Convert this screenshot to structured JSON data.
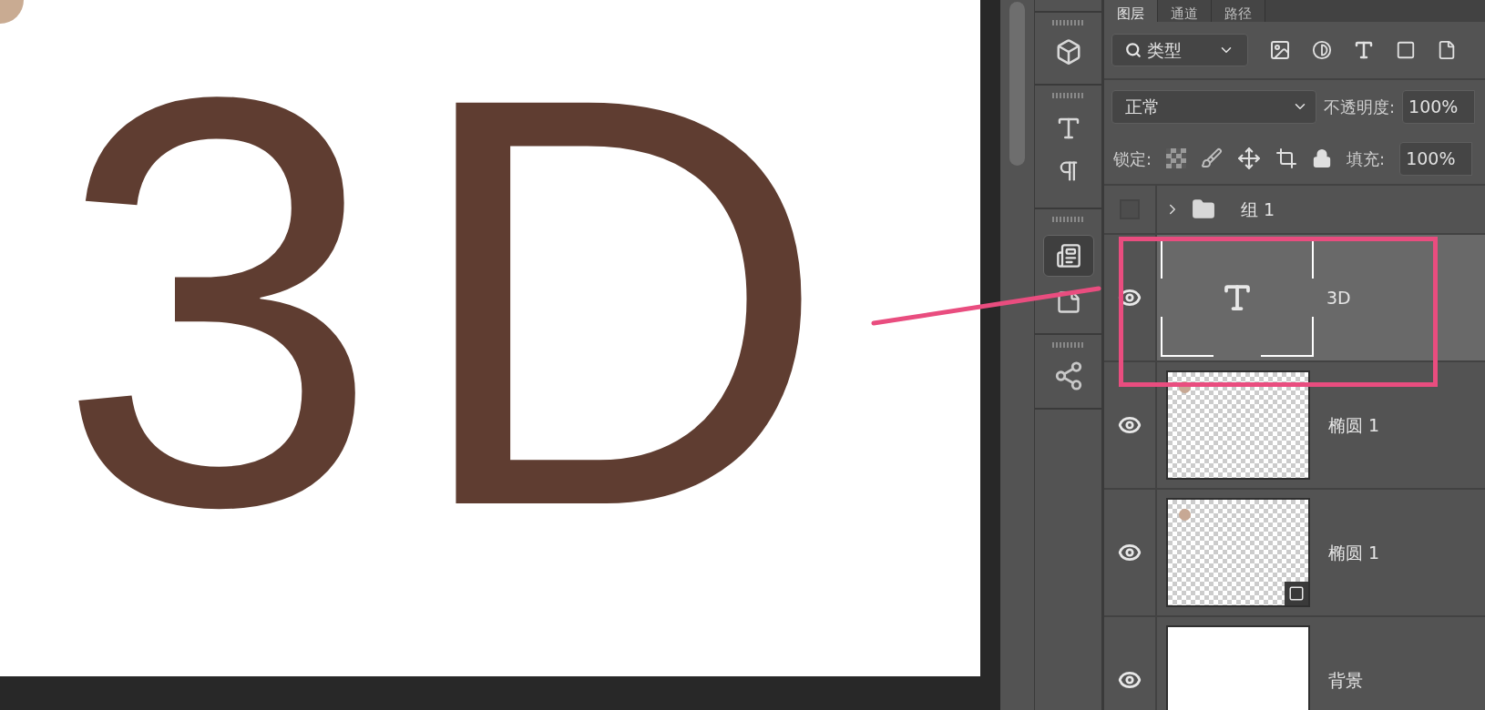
{
  "canvas": {
    "text": "3D"
  },
  "panel_tabs": [
    {
      "label": "图层",
      "selected": true
    },
    {
      "label": "通道",
      "selected": false
    },
    {
      "label": "路径",
      "selected": false
    }
  ],
  "filter": {
    "value": "类型"
  },
  "blend_mode": {
    "value": "正常"
  },
  "opacity": {
    "label": "不透明度:",
    "value": "100%"
  },
  "lock": {
    "label": "锁定:"
  },
  "fill": {
    "label": "填充:",
    "value": "100%"
  },
  "layers": [
    {
      "kind": "group",
      "name": "组 1",
      "visible": false,
      "expanded": false,
      "selected": false
    },
    {
      "kind": "text",
      "name": "3D",
      "visible": true,
      "selected": true
    },
    {
      "kind": "shape",
      "name": "椭圆 1",
      "visible": true,
      "selected": false,
      "badge": false
    },
    {
      "kind": "shape",
      "name": "椭圆 1",
      "visible": true,
      "selected": false,
      "badge": true
    },
    {
      "kind": "pixel",
      "name": "背景",
      "visible": true,
      "selected": false
    }
  ]
}
